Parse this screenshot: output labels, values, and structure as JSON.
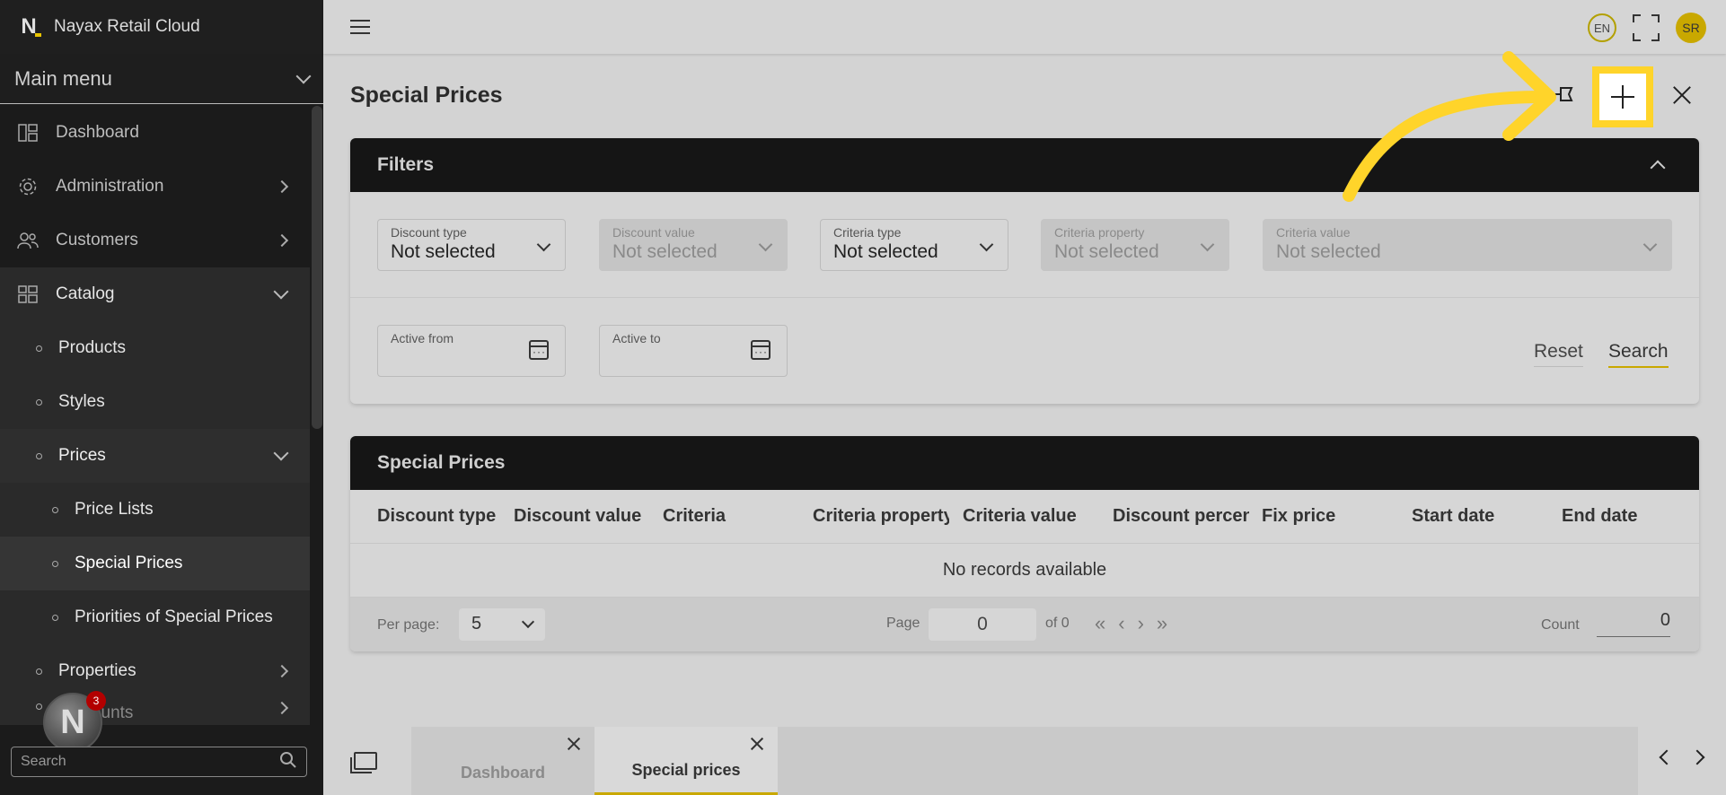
{
  "app": {
    "name": "Nayax Retail Cloud"
  },
  "sidebar": {
    "main_menu_label": "Main menu",
    "items": [
      {
        "label": "Dashboard"
      },
      {
        "label": "Administration"
      },
      {
        "label": "Customers"
      },
      {
        "label": "Catalog"
      },
      {
        "label": "Products"
      },
      {
        "label": "Styles"
      },
      {
        "label": "Prices"
      },
      {
        "label": "Price Lists"
      },
      {
        "label": "Special Prices"
      },
      {
        "label": "Priorities of Special Prices"
      },
      {
        "label": "Properties"
      },
      {
        "label": "Discounts"
      }
    ],
    "search_placeholder": "Search",
    "notification_count": "3"
  },
  "topbar": {
    "language": "EN",
    "user_initials": "SR"
  },
  "page": {
    "title": "Special Prices"
  },
  "filters": {
    "title": "Filters",
    "discount_type": {
      "label": "Discount type",
      "value": "Not selected"
    },
    "discount_value": {
      "label": "Discount value",
      "value": "Not selected"
    },
    "criteria_type": {
      "label": "Criteria type",
      "value": "Not selected"
    },
    "criteria_property": {
      "label": "Criteria property",
      "value": "Not selected"
    },
    "criteria_value": {
      "label": "Criteria value",
      "value": "Not selected"
    },
    "active_from": {
      "label": "Active from"
    },
    "active_to": {
      "label": "Active to"
    },
    "reset_label": "Reset",
    "search_label": "Search"
  },
  "table": {
    "title": "Special Prices",
    "columns": [
      "Discount type",
      "Discount value",
      "Criteria",
      "Criteria property",
      "Criteria value",
      "Discount percent",
      "Fix price",
      "Start date",
      "End date"
    ],
    "empty_text": "No records available",
    "per_page_label": "Per page:",
    "per_page_value": "5",
    "page_label": "Page",
    "page_value": "0",
    "of_label": "of 0",
    "count_label": "Count",
    "count_value": "0"
  },
  "bottom_tabs": [
    {
      "label": "Dashboard"
    },
    {
      "label": "Special prices"
    }
  ],
  "colors": {
    "accent": "#ffd42a",
    "sidebar_bg": "#1b1b1b",
    "header_bg": "#151515"
  }
}
